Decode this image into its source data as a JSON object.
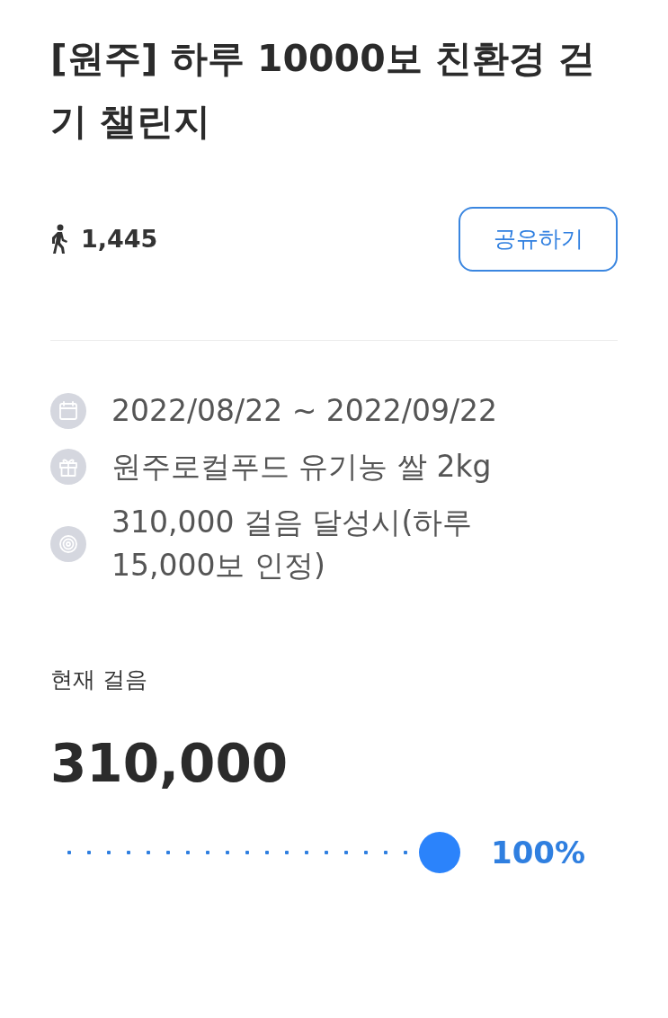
{
  "title": "[원주] 하루 10000보 친환경 걷기 챌린지",
  "participants": "1,445",
  "share_button": "공유하기",
  "info": [
    {
      "kind": "calendar",
      "text": "2022/08/22 ~ 2022/09/22"
    },
    {
      "kind": "gift",
      "text": "원주로컬푸드 유기농 쌀 2kg"
    },
    {
      "kind": "target",
      "text": "310,000 걸음 달성시(하루 15,000보 인정)"
    }
  ],
  "current": {
    "label": "현재 걸음",
    "value": "310,000",
    "level": 1,
    "percent": "100%"
  }
}
